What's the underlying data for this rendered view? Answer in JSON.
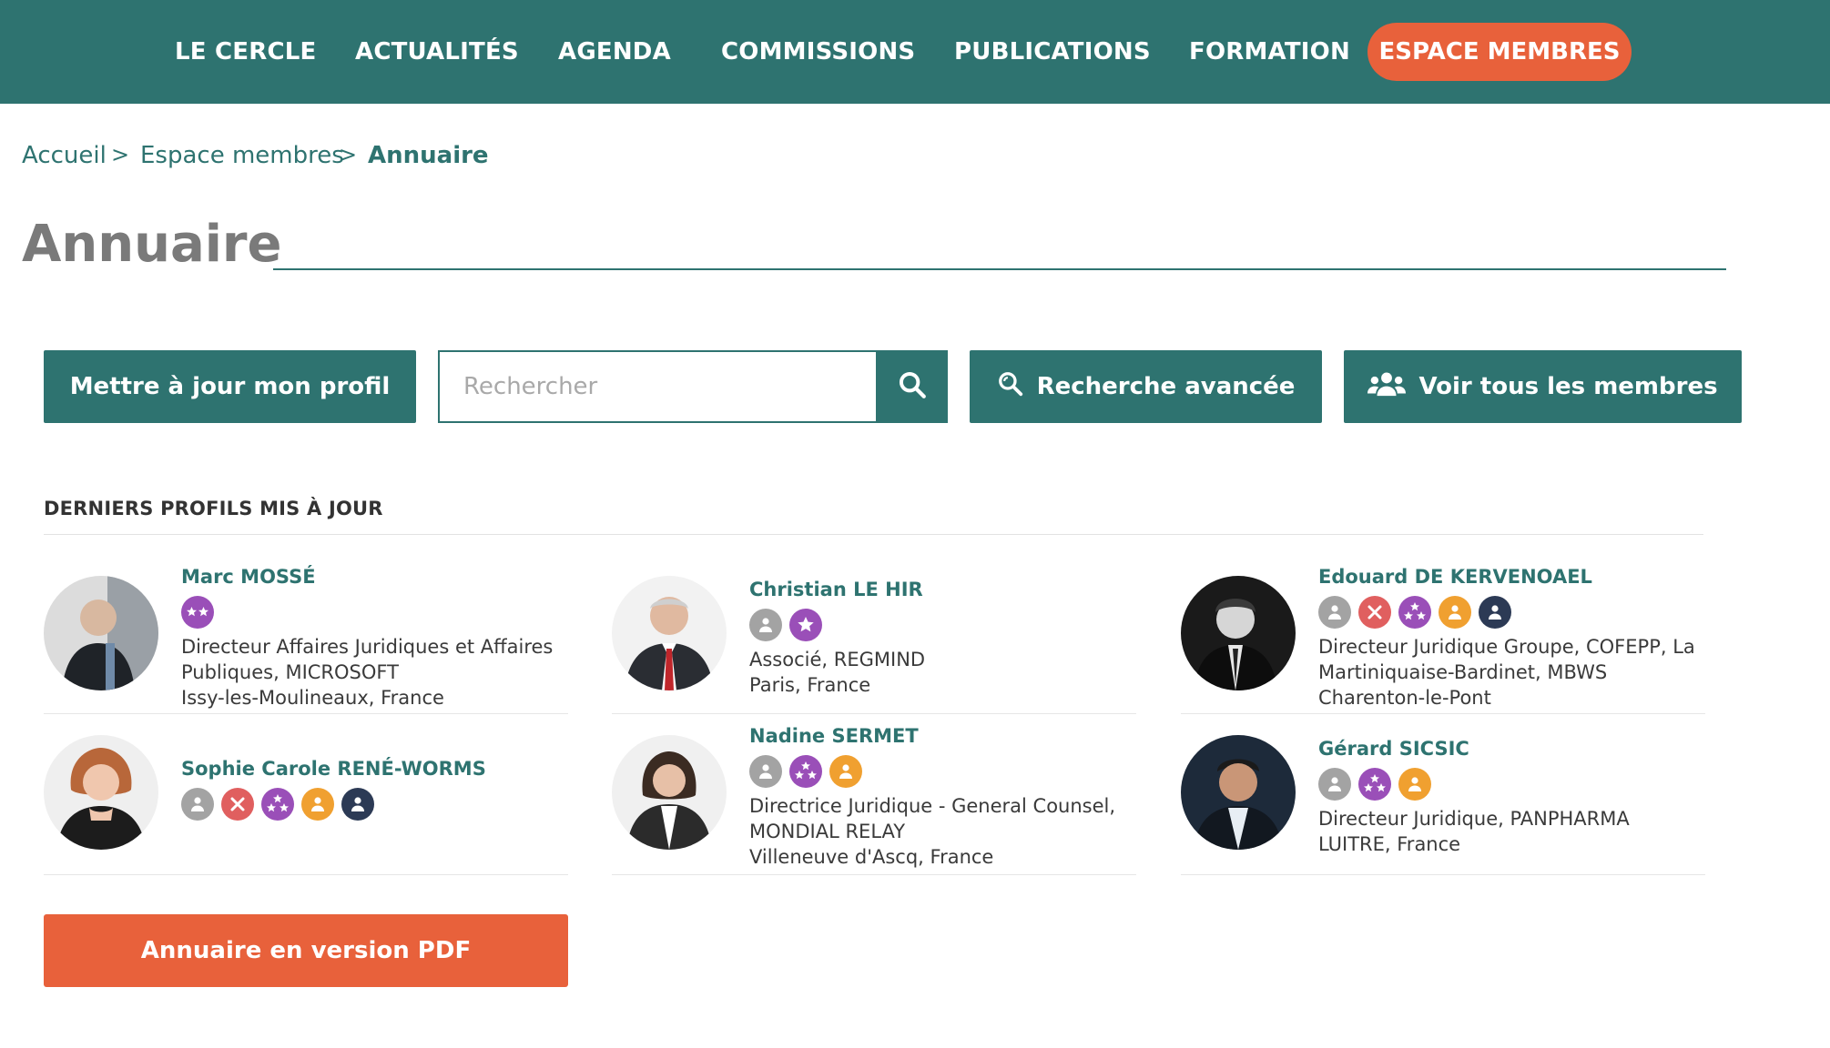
{
  "nav": {
    "items": [
      {
        "label": "LE CERCLE"
      },
      {
        "label": "ACTUALITÉS"
      },
      {
        "label": "AGENDA"
      },
      {
        "label": "COMMISSIONS"
      },
      {
        "label": "PUBLICATIONS"
      },
      {
        "label": "FORMATION"
      }
    ],
    "cta_label": "ESPACE MEMBRES"
  },
  "breadcrumb": {
    "items": [
      "Accueil",
      "Espace membres",
      "Annuaire"
    ],
    "separator": ">"
  },
  "page": {
    "title": "Annuaire"
  },
  "actions": {
    "update_profile_label": "Mettre à jour mon profil",
    "search_placeholder": "Rechercher",
    "advanced_search_label": "Recherche avancée",
    "all_members_label": "Voir tous les membres",
    "pdf_label": "Annuaire en version PDF"
  },
  "section": {
    "title": "DERNIERS PROFILS MIS À JOUR"
  },
  "badge_colors": {
    "grey": "#a3a3a3",
    "red": "#e05f5f",
    "purple": "#9a4fb8",
    "orange": "#f0a030",
    "navy": "#2c3a55"
  },
  "profiles": [
    {
      "name": "Marc MOSSÉ",
      "badges": [
        "stars2"
      ],
      "lines": [
        "Directeur Affaires Juridiques et Affaires",
        "Publiques, MICROSOFT",
        "Issy-les-Moulineaux, France"
      ]
    },
    {
      "name": "Christian LE HIR",
      "badges": [
        "grey",
        "star1"
      ],
      "lines": [
        "Associé, REGMIND",
        "Paris, France"
      ]
    },
    {
      "name": "Edouard DE KERVENOAEL",
      "badges": [
        "grey",
        "red",
        "stars3",
        "orange",
        "navy"
      ],
      "lines": [
        "Directeur Juridique Groupe, COFEPP, La",
        "Martiniquaise-Bardinet, MBWS",
        "Charenton-le-Pont"
      ]
    },
    {
      "name": "Sophie Carole RENÉ-WORMS",
      "badges": [
        "grey",
        "red",
        "stars3",
        "orange",
        "navy"
      ],
      "lines": []
    },
    {
      "name": "Nadine SERMET",
      "badges": [
        "grey",
        "stars3",
        "orange"
      ],
      "lines": [
        "Directrice Juridique - General Counsel,",
        "MONDIAL RELAY",
        "Villeneuve d'Ascq, France"
      ]
    },
    {
      "name": "Gérard SICSIC",
      "badges": [
        "grey",
        "stars3",
        "orange"
      ],
      "lines": [
        "Directeur Juridique, PANPHARMA",
        "LUITRE, France"
      ]
    }
  ]
}
